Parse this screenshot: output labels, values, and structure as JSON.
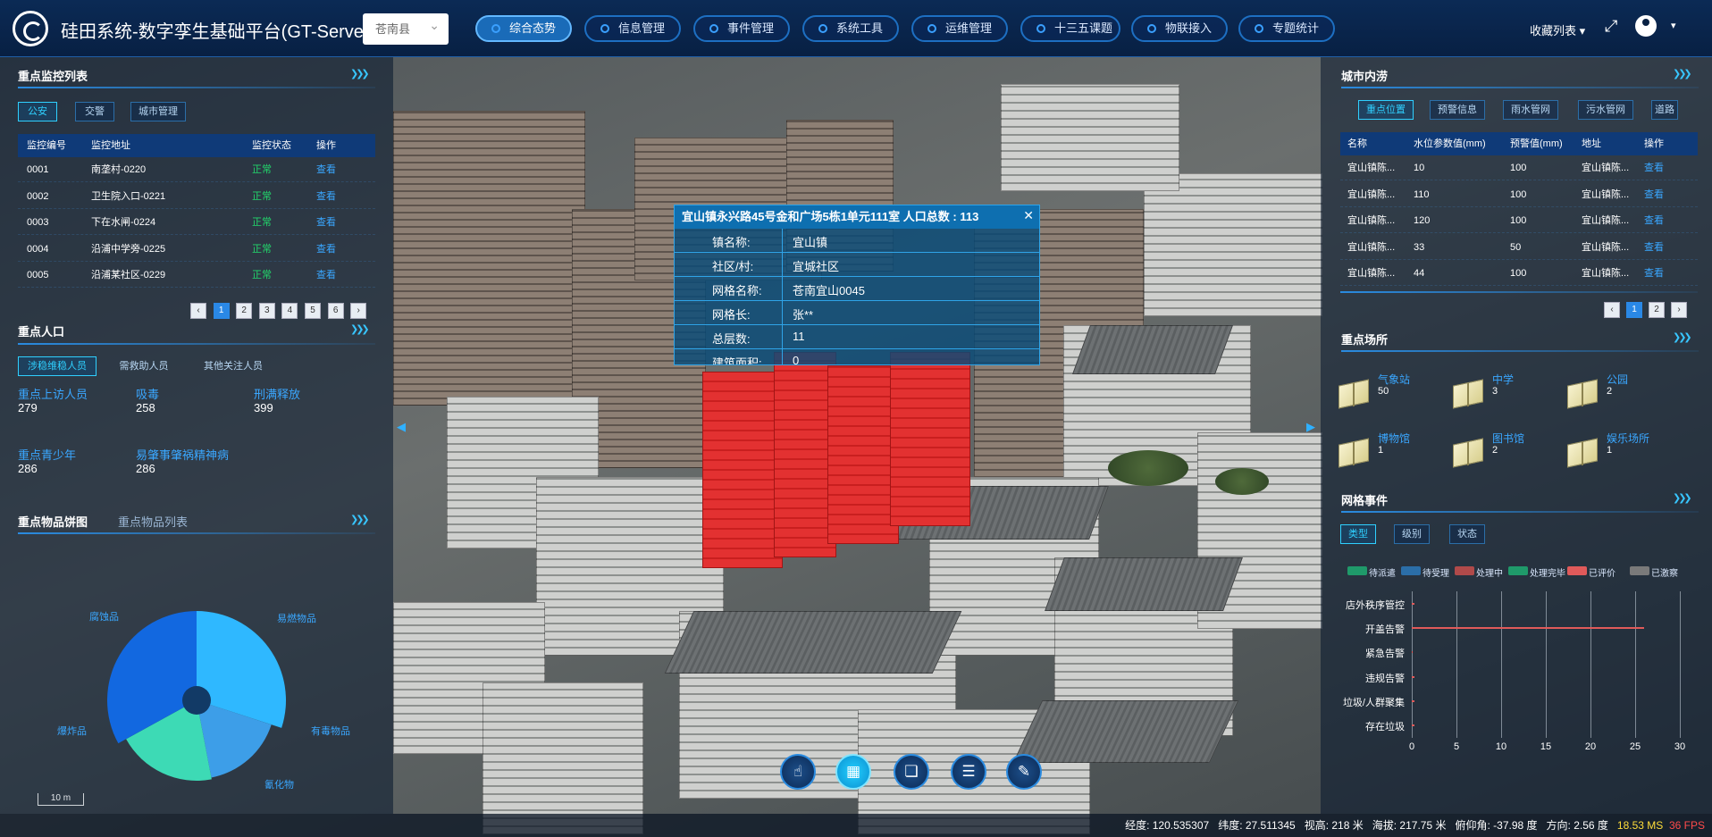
{
  "app": {
    "title": "硅田系统-数字孪生基础平台(GT-Server)",
    "county": "苍南县"
  },
  "nav": [
    {
      "label": "综合态势",
      "active": true
    },
    {
      "label": "信息管理"
    },
    {
      "label": "事件管理"
    },
    {
      "label": "系统工具"
    },
    {
      "label": "运维管理"
    },
    {
      "label": "十三五课题"
    },
    {
      "label": "物联接入"
    },
    {
      "label": "专题统计"
    }
  ],
  "header_right": {
    "favorites": "收藏列表 ▾",
    "fullscreen_icon": "fullscreen-icon",
    "user_icon": "user-icon",
    "caret": "▾"
  },
  "left": {
    "monitor": {
      "title": "重点监控列表",
      "tabs": [
        "公安",
        "交警",
        "城市管理"
      ],
      "columns": [
        "监控编号",
        "监控地址",
        "监控状态",
        "操作"
      ],
      "rows": [
        [
          "0001",
          "南垄村-0220",
          "正常",
          "查看"
        ],
        [
          "0002",
          "卫生院入口-0221",
          "正常",
          "查看"
        ],
        [
          "0003",
          "下在水闸-0224",
          "正常",
          "查看"
        ],
        [
          "0004",
          "沿浦中学旁-0225",
          "正常",
          "查看"
        ],
        [
          "0005",
          "沿浦某社区-0229",
          "正常",
          "查看"
        ]
      ],
      "pages": [
        "‹",
        "1",
        "2",
        "3",
        "4",
        "5",
        "6",
        "›"
      ]
    },
    "people": {
      "title": "重点人口",
      "tabs": [
        "涉稳维稳人员",
        "需救助人员",
        "其他关注人员"
      ],
      "stats": [
        {
          "label": "重点上访人员",
          "value": "279"
        },
        {
          "label": "吸毒",
          "value": "258"
        },
        {
          "label": "刑满释放",
          "value": "399"
        },
        {
          "label": "重点青少年",
          "value": "286"
        },
        {
          "label": "易肇事肇祸精神病",
          "value": "286"
        }
      ]
    },
    "goods": {
      "tabs": [
        "重点物品饼图",
        "重点物品列表"
      ],
      "chart_data": {
        "type": "pie",
        "slices": [
          {
            "label": "腐蚀品",
            "value": 30,
            "color": "#2fb8ff"
          },
          {
            "label": "易燃物品",
            "value": 0,
            "color": "#2fb8ff"
          },
          {
            "label": "有毒物品",
            "value": 17,
            "color": "#3d9ee8"
          },
          {
            "label": "氰化物",
            "value": 20,
            "color": "#3ddab5"
          },
          {
            "label": "爆炸品",
            "value": 33,
            "color": "#1268e0"
          }
        ]
      }
    }
  },
  "right": {
    "waterlog": {
      "title": "城市内涝",
      "tabs": [
        "重点位置",
        "预警信息",
        "雨水管网",
        "污水管网",
        "道路"
      ],
      "columns": [
        "名称",
        "水位参数值(mm)",
        "预警值(mm)",
        "地址",
        "操作"
      ],
      "rows": [
        [
          "宜山镇陈...",
          "10",
          "100",
          "宜山镇陈...",
          "查看"
        ],
        [
          "宜山镇陈...",
          "110",
          "100",
          "宜山镇陈...",
          "查看"
        ],
        [
          "宜山镇陈...",
          "120",
          "100",
          "宜山镇陈...",
          "查看"
        ],
        [
          "宜山镇陈...",
          "33",
          "50",
          "宜山镇陈...",
          "查看"
        ],
        [
          "宜山镇陈...",
          "44",
          "100",
          "宜山镇陈...",
          "查看"
        ]
      ],
      "pages": [
        "‹",
        "1",
        "2",
        "›"
      ]
    },
    "places": {
      "title": "重点场所",
      "items": [
        {
          "name": "气象站",
          "count": "50"
        },
        {
          "name": "中学",
          "count": "3"
        },
        {
          "name": "公园",
          "count": "2"
        },
        {
          "name": "博物馆",
          "count": "1"
        },
        {
          "name": "图书馆",
          "count": "2"
        },
        {
          "name": "娱乐场所",
          "count": "1"
        }
      ]
    },
    "events": {
      "title": "网格事件",
      "tabs": [
        "类型",
        "级别",
        "状态"
      ],
      "legend": [
        {
          "label": "待派遣",
          "color": "#1f9a6a"
        },
        {
          "label": "待受理",
          "color": "#2b6ea8"
        },
        {
          "label": "处理中",
          "color": "#b04a4a"
        },
        {
          "label": "处理完毕",
          "color": "#1f9a6a"
        },
        {
          "label": "已评价",
          "color": "#e05a5a"
        },
        {
          "label": "已激察",
          "color": "#7a7a7a"
        }
      ],
      "chart_data": {
        "type": "bar",
        "categories": [
          "店外秩序管控",
          "开盖告警",
          "紧急告警",
          "违规告警",
          "垃圾/人群聚集",
          "存在垃圾"
        ],
        "xlim": [
          0,
          30
        ],
        "xticks": [
          "0",
          "5",
          "10",
          "15",
          "20",
          "25",
          "30"
        ],
        "series": [
          {
            "values": [
              0.3,
              26,
              0,
              0.3,
              0.3,
              0.3
            ],
            "color": "#e05a5a"
          }
        ]
      }
    }
  },
  "popup": {
    "title": "宜山镇永兴路45号金和广场5栋1单元111室 人口总数 : 113",
    "rows": [
      {
        "k": "镇名称:",
        "v": "宜山镇"
      },
      {
        "k": "社区/村:",
        "v": "宜城社区"
      },
      {
        "k": "网格名称:",
        "v": "苍南宜山0045"
      },
      {
        "k": "网格长:",
        "v": "张**"
      },
      {
        "k": "总层数:",
        "v": "11"
      },
      {
        "k": "建筑面积:",
        "v": "0"
      }
    ]
  },
  "tools": [
    "hand-icon",
    "building-icon",
    "layers-icon",
    "list-icon",
    "brush-icon"
  ],
  "scale": "10 m",
  "status": {
    "lon": "经度: 120.535307",
    "lat": "纬度: 27.511345",
    "view": "视高: 218 米",
    "alt": "海拔: 217.75 米",
    "pitch": "俯仰角: -37.98 度",
    "heading": "方向: 2.56 度",
    "ms": "18.53 MS",
    "fps": "36 FPS"
  }
}
